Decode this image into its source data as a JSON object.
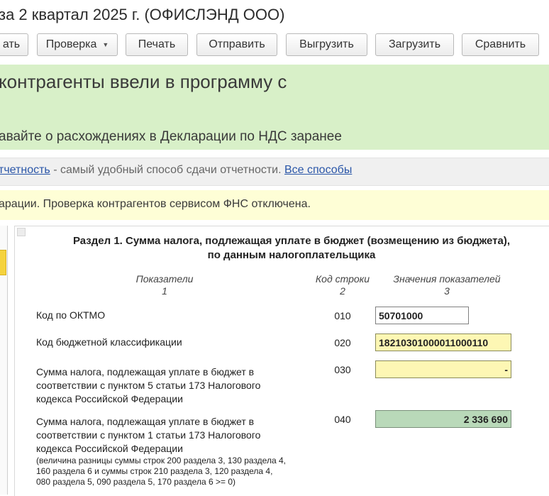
{
  "window": {
    "title": "за 2 квартал 2025 г. (ОФИСЛЭНД ООО)"
  },
  "toolbar": {
    "buttons": [
      "ать",
      "Проверка",
      "Печать",
      "Отправить",
      "Выгрузить",
      "Загрузить",
      "Сравнить"
    ]
  },
  "banner": {
    "heading": "контрагенты ввели в программу с",
    "subheading": "авайте о расхождениях в Декларации по НДС заранее"
  },
  "info_bar": {
    "link1": "тчетность",
    "text": " - самый удобный способ сдачи отчетности. ",
    "link2": "Все способы"
  },
  "notice_bar": {
    "text": "арации. Проверка контрагентов сервисом ФНС отключена."
  },
  "form": {
    "section_title_line1": "Раздел 1. Сумма налога, подлежащая уплате в бюджет (возмещению из бюджета),",
    "section_title_line2": "по данным налогоплательщика",
    "columns": {
      "col1_title": "Показатели",
      "col1_num": "1",
      "col2_title": "Код строки",
      "col2_num": "2",
      "col3_title": "Значения показателей",
      "col3_num": "3"
    },
    "rows": [
      {
        "label": "Код по ОКТМО",
        "code": "010",
        "value": "50701000"
      },
      {
        "label": "Код бюджетной классификации",
        "code": "020",
        "value": "18210301000011000110"
      },
      {
        "label_lines": [
          "Сумма налога, подлежащая уплате в бюджет в",
          "соответствии с пунктом 5 статьи 173 Налогового",
          "кодекса Российской Федерации"
        ],
        "code": "030",
        "value": "-"
      },
      {
        "label_lines": [
          "Сумма налога, подлежащая уплате в бюджет в",
          "соответствии с пунктом 1 статьи 173 Налогового",
          "кодекса Российской Федерации"
        ],
        "note_lines": [
          "(величина разницы суммы строк 200 раздела 3, 130 раздела 4,",
          "160 раздела 6 и суммы строк 210 раздела 3, 120 раздела 4,",
          "080 раздела 5, 090 раздела 5, 170 раздела 6 >= 0)"
        ],
        "code": "040",
        "value": "2 336 690"
      }
    ]
  },
  "colors": {
    "banner_green": "#d8f0c8",
    "notice_yellow": "#fefed6",
    "field_yellow": "#fdf7b4",
    "field_green": "#b9d9b9",
    "link_blue": "#2a56a8"
  }
}
